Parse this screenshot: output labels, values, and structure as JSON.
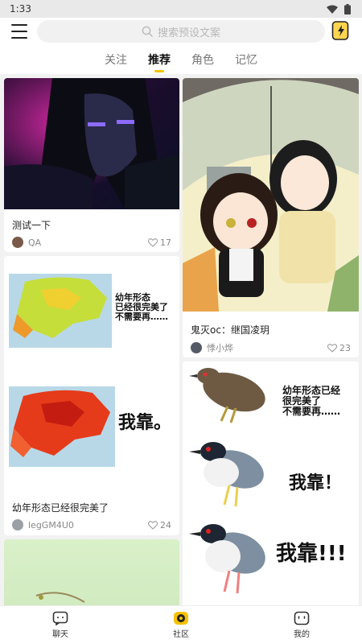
{
  "status_bar": {
    "time": "1:33"
  },
  "search": {
    "placeholder": "搜索预设文案"
  },
  "tabs": [
    {
      "label": "关注",
      "active": false
    },
    {
      "label": "推荐",
      "active": true
    },
    {
      "label": "角色",
      "active": false
    },
    {
      "label": "记忆",
      "active": false
    }
  ],
  "posts": [
    {
      "title": "测试一下",
      "author": "QA",
      "likes": "17"
    },
    {
      "title": "鬼灭oc：继国凌玥",
      "author": "悸小烨",
      "likes": "23"
    },
    {
      "title": "幼年形态已经很完美了",
      "author": "legGM4U0",
      "likes": "24",
      "meme_captions": [
        "幼年形态",
        "已经很完美了",
        "不需要再……",
        "我靠。"
      ]
    },
    {
      "title": "",
      "meme_captions": [
        "幼年形态已经",
        "很完美了",
        "不需要再……",
        "我靠！",
        "我靠!!!"
      ]
    }
  ],
  "bottom_nav": [
    {
      "label": "聊天",
      "icon": "chat-icon"
    },
    {
      "label": "社区",
      "icon": "community-icon",
      "active": true
    },
    {
      "label": "我的",
      "icon": "profile-icon"
    }
  ],
  "colors": {
    "accent": "#f6c100",
    "text": "#222222",
    "muted": "#888888",
    "background": "#f2f2f2"
  }
}
